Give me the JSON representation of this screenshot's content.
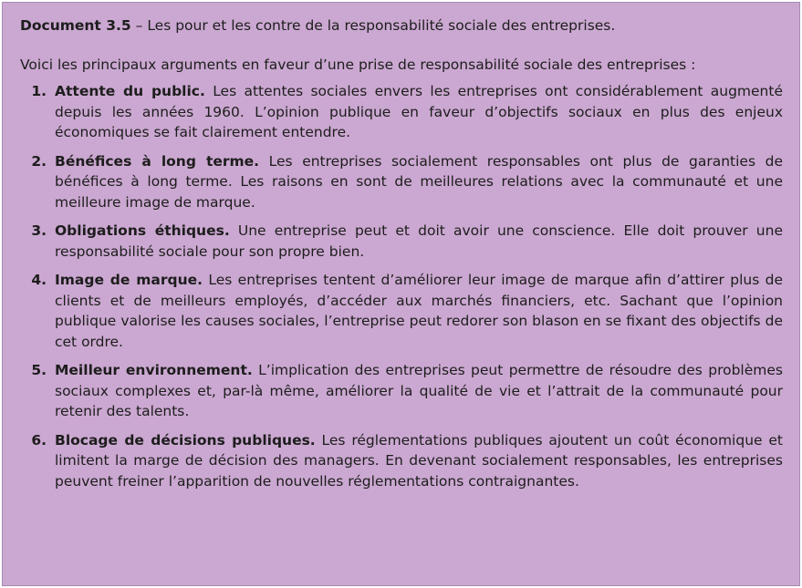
{
  "document": {
    "label": "Document 3.5",
    "separator": " – ",
    "title": "Les pour et les contre de la responsabilité sociale des entreprises.",
    "intro": "Voici les principaux arguments en faveur d’une prise de responsabilité sociale des entreprises :",
    "items": [
      {
        "number": "1.",
        "heading": "Attente du public.",
        "body": " Les attentes sociales envers les entreprises ont considérablement augmenté depuis les années 1960. L’opinion publique en faveur d’objectifs sociaux en plus des enjeux économiques se fait clairement entendre."
      },
      {
        "number": "2.",
        "heading": "Bénéfices à long terme.",
        "body": " Les entreprises socialement responsables ont plus de garanties de bénéfices à long terme. Les raisons en sont de meilleures relations avec la communauté et une meilleure image de marque."
      },
      {
        "number": "3.",
        "heading": "Obligations éthiques.",
        "body": " Une entreprise peut et doit avoir une conscience. Elle doit prouver une responsabilité sociale pour son propre bien."
      },
      {
        "number": "4.",
        "heading": "Image de marque.",
        "body": " Les entreprises tentent d’améliorer leur image de marque afin d’attirer plus de clients et de meilleurs employés, d’accéder aux marchés financiers, etc. Sachant que l’opinion publique valorise les causes sociales, l’entreprise peut redorer son blason en se fixant des objectifs de cet ordre."
      },
      {
        "number": "5.",
        "heading": "Meilleur environnement.",
        "body": " L’implication des entreprises peut permettre de résoudre des problèmes sociaux complexes et, par-là même, améliorer la qualité de vie et l’attrait de la communauté pour retenir des talents."
      },
      {
        "number": "6.",
        "heading": "Blocage de décisions publiques.",
        "body": " Les réglementations publiques ajoutent un coût économique et limitent la marge de décision des managers. En devenant socialement responsables, les entreprises peuvent freiner l’apparition de nouvelles réglementations contraignantes."
      }
    ]
  },
  "colors": {
    "background": "#cba8d1",
    "text": "#1d1d1d"
  }
}
